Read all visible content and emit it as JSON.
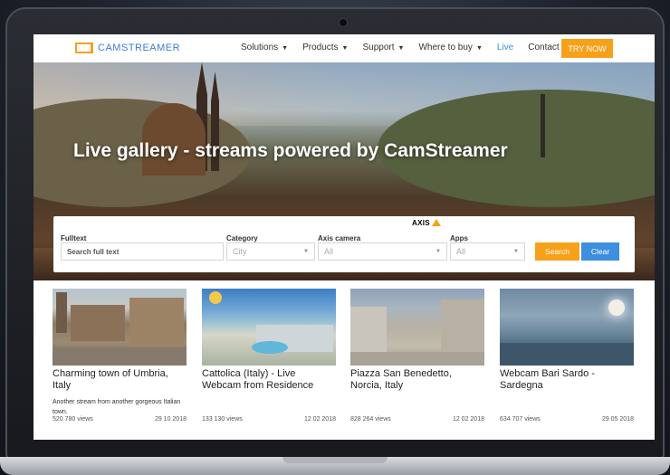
{
  "nav": {
    "logo_text": "CAMSTREAMER",
    "items": [
      {
        "label": "Solutions",
        "has_caret": true
      },
      {
        "label": "Products",
        "has_caret": true
      },
      {
        "label": "Support",
        "has_caret": true
      },
      {
        "label": "Where to buy",
        "has_caret": true
      },
      {
        "label": "Live",
        "has_caret": false
      },
      {
        "label": "Contact",
        "has_caret": false
      }
    ],
    "cta_label": "TRY NOW"
  },
  "hero": {
    "title": "Live gallery - streams powered by CamStreamer"
  },
  "search": {
    "fulltext_label": "Fulltext",
    "fulltext_placeholder": "Search full text",
    "category_label": "Category",
    "category_value": "City",
    "axis_label": "Axis camera",
    "axis_logo": "AXIS",
    "axis_value": "All",
    "apps_label": "Apps",
    "apps_value": "All",
    "search_button": "Search",
    "clear_button": "Clear"
  },
  "cards": [
    {
      "title": "Charming town of Umbria, Italy",
      "description": "Another stream from another gorgeous Italian town.",
      "views": "520 780 views",
      "date": "29 10 2018"
    },
    {
      "title": "Cattolica (Italy) - Live Webcam from Residence",
      "description": "",
      "views": "133 130 views",
      "date": "12 02 2018"
    },
    {
      "title": "Piazza San Benedetto, Norcia, Italy",
      "description": "",
      "views": "828 264 views",
      "date": "12 02 2018"
    },
    {
      "title": "Webcam Bari Sardo - Sardegna",
      "description": "",
      "views": "634 707 views",
      "date": "29 05 2018"
    }
  ],
  "colors": {
    "accent_orange": "#f7a11a",
    "accent_blue": "#3d8fe0"
  },
  "icons": [
    "camstreamer-logo-icon",
    "chevron-down-icon",
    "axis-logo-icon"
  ]
}
